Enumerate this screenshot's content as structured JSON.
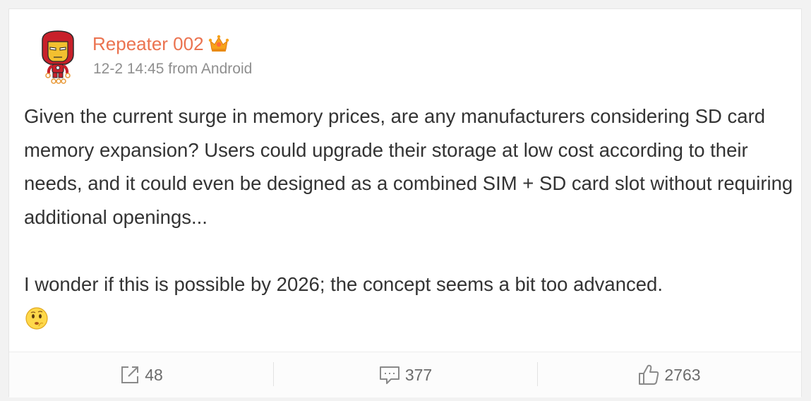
{
  "post": {
    "author": "Repeater 002",
    "meta": "12-2 14:45 from Android",
    "paragraphs": [
      "Given the current surge in memory prices, are any manufacturers considering SD card memory expansion? Users could upgrade their storage at low cost according to their needs, and it could even be designed as a combined SIM + SD card slot without requiring additional openings...",
      "I wonder if this is possible by 2026; the concept seems a bit too advanced."
    ],
    "trailing_emoji": "thinking-face-icon"
  },
  "actions": {
    "repost": {
      "icon": "share-icon",
      "count": "48"
    },
    "comment": {
      "icon": "comment-icon",
      "count": "377"
    },
    "like": {
      "icon": "thumbs-up-icon",
      "count": "2763"
    }
  },
  "colors": {
    "author_name": "#eb7350",
    "meta_text": "#8f8f8f",
    "body_text": "#333333",
    "action_text": "#6b6b6b"
  }
}
